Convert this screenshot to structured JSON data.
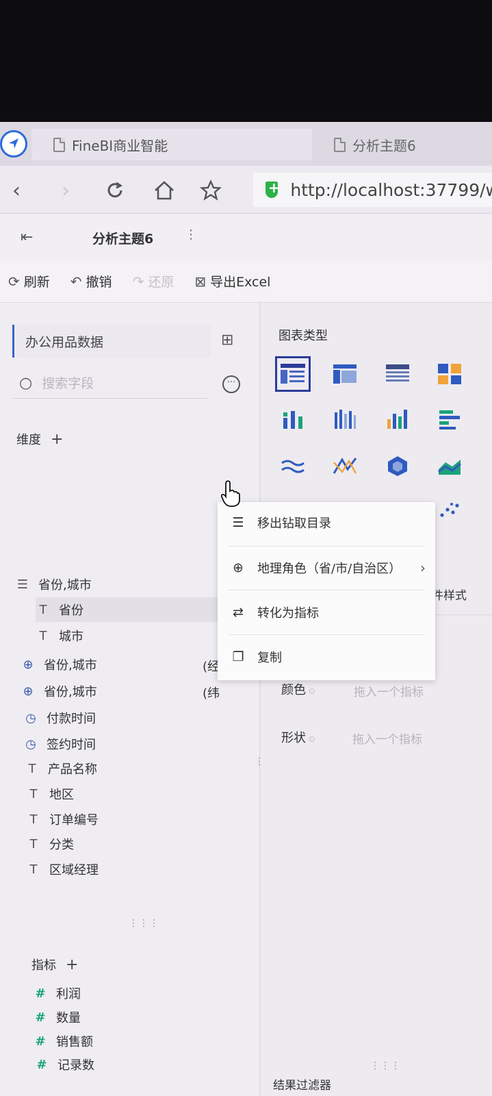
{
  "browser": {
    "tabs": [
      {
        "label": "FineBI商业智能"
      },
      {
        "label": "分析主题6"
      }
    ],
    "url": "http://localhost:37799/w"
  },
  "app": {
    "title": "分析主题6"
  },
  "toolbar": {
    "refresh": "刷新",
    "undo": "撤销",
    "redo": "还原",
    "export": "导出Excel"
  },
  "left_panel": {
    "dataset": "办公用品数据",
    "search_placeholder": "搜索字段",
    "dimension_title": "维度",
    "dimensions": [
      {
        "icon": "drill-tree-icon",
        "label": "省份,城市"
      },
      {
        "icon": "text-type-icon",
        "label": "省份"
      },
      {
        "icon": "text-type-icon",
        "label": "城市"
      },
      {
        "icon": "globe-icon",
        "label": "省份,城市",
        "suffix": "(经"
      },
      {
        "icon": "globe-icon",
        "label": "省份,城市",
        "suffix": "(纬"
      },
      {
        "icon": "clock-icon",
        "label": "付款时间"
      },
      {
        "icon": "clock-icon",
        "label": "签约时间"
      },
      {
        "icon": "text-type-icon",
        "label": "产品名称"
      },
      {
        "icon": "text-type-icon",
        "label": "地区"
      },
      {
        "icon": "text-type-icon",
        "label": "订单编号"
      },
      {
        "icon": "text-type-icon",
        "label": "分类"
      },
      {
        "icon": "text-type-icon",
        "label": "区域经理"
      }
    ],
    "measure_title": "指标",
    "measures": [
      {
        "icon": "number-type-icon",
        "label": "利润"
      },
      {
        "icon": "number-type-icon",
        "label": "数量"
      },
      {
        "icon": "number-type-icon",
        "label": "销售额"
      },
      {
        "icon": "number-type-icon",
        "label": "记录数"
      }
    ]
  },
  "right_panel": {
    "chart_type_title": "图表类型",
    "component_style": "件样式",
    "color_label": "颜色",
    "color_hint": "拖入一个指标",
    "shape_label": "形状",
    "shape_hint": "拖入一个指标",
    "result_filter": "结果过滤器"
  },
  "context_menu": {
    "items": [
      {
        "icon": "drill-tree-icon",
        "label": "移出钻取目录"
      },
      {
        "icon": "globe-icon",
        "label": "地理角色（省/市/自治区）",
        "has_submenu": true
      },
      {
        "icon": "swap-icon",
        "label": "转化为指标"
      },
      {
        "icon": "copy-icon",
        "label": "复制"
      }
    ]
  },
  "colors": {
    "accent_blue": "#3566c8",
    "selected_border": "#2b3c9a",
    "measure_green": "#1aa37a",
    "secure_green": "#2fb14a"
  }
}
